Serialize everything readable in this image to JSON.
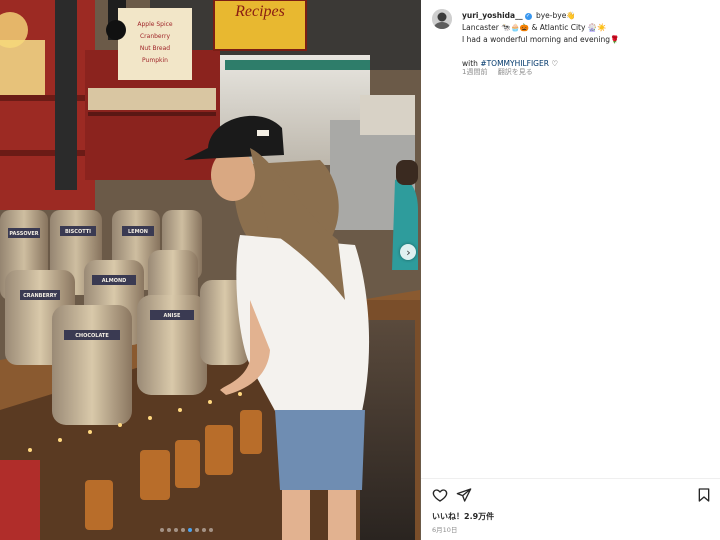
{
  "photo": {
    "sign_text": "Recipes",
    "board_lines": [
      "Apple Spice",
      "Cranberry",
      "Nut Bread",
      "Pumpkin"
    ],
    "jar_labels": [
      "PASSOVER",
      "BISCOTTI",
      "CRANBERRY",
      "ALMOND",
      "CHOCOLATE",
      "ANISE",
      "LEMON"
    ],
    "carousel_total": 8,
    "carousel_active_index": 4
  },
  "post": {
    "username": "yuri_yoshida__",
    "verified_glyph": "✓",
    "caption_start": "bye-bye👋",
    "caption_line2": "Lancaster 🐄🧁🎃 & Atlantic City 🎡☀️",
    "caption_line3": "I had a wonderful morning and evening🌹",
    "with_text": "with",
    "hashtag": "#TOMMYHILFIGER",
    "heart_emoji": "♡",
    "time_ago": "1週間前",
    "see_translation": "翻訳を見る",
    "likes_text": "いいね！2.9万件",
    "date": "6月10日"
  },
  "icons": {
    "next": "chevron-right-icon",
    "like": "heart-icon",
    "share": "send-icon",
    "save": "bookmark-icon"
  },
  "colors": {
    "hashtag": "#00376b",
    "verified": "#3897f0",
    "meta": "#8e8e8e",
    "active_dot": "#4aa3f0"
  }
}
